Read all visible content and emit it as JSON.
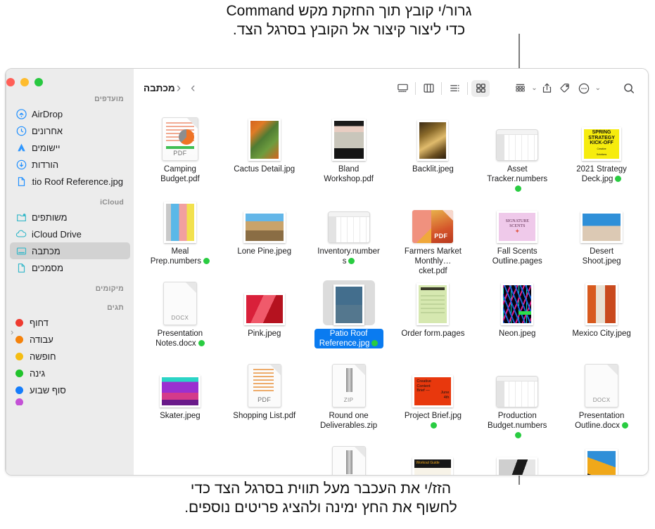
{
  "annotations": {
    "top": "גרור/י קובץ תוך החזקת מקש Command\nכדי ליצור קיצור אל הקובץ בסרגל הצד.",
    "bottom": "הזז/י את העכבר מעל תווית בסרגל הצד כדי\nלחשוף את החץ ימינה ולהציג פריטים נוספים."
  },
  "window": {
    "toolbar": {
      "title": "מכתבה",
      "back_label": "‹",
      "forward_label": "›",
      "search_icon": "search-icon",
      "more_icon": "more-ellipsis-icon",
      "tag_icon": "tag-icon",
      "share_icon": "share-icon",
      "group_icon": "group-by-icon",
      "view_gallery_icon": "gallery-view-icon",
      "view_column_icon": "column-view-icon",
      "view_list_icon": "list-view-icon",
      "view_icon_icon": "icon-view-icon",
      "chevron_label": "⌄"
    },
    "sidebar": {
      "traffic_lights": [
        "#ff5f57",
        "#febc2e",
        "#28c840"
      ],
      "sections": [
        {
          "header": "מועדפים",
          "items": [
            {
              "label": "AirDrop",
              "icon": "airdrop-icon",
              "selected": false
            },
            {
              "label": "אחרונים",
              "icon": "clock-icon",
              "selected": false
            },
            {
              "label": "יישומים",
              "icon": "applications-icon",
              "selected": false
            },
            {
              "label": "הורדות",
              "icon": "downloads-icon",
              "selected": false
            },
            {
              "label": "Patio Roof Reference.jpg",
              "icon": "document-icon",
              "selected": false
            }
          ]
        },
        {
          "header": "iCloud",
          "items": [
            {
              "label": "משותפים",
              "icon": "shared-folder-icon",
              "selected": false
            },
            {
              "label": "iCloud Drive",
              "icon": "cloud-icon",
              "selected": false
            },
            {
              "label": "מכתבה",
              "icon": "desktop-icon",
              "selected": true
            },
            {
              "label": "מסמכים",
              "icon": "document-icon",
              "selected": false
            }
          ]
        },
        {
          "header": "מיקומים",
          "items": []
        },
        {
          "header": "תגים",
          "items": [
            {
              "label": "דחוף",
              "icon": "tag-dot",
              "color": "#ee3b30",
              "selected": false
            },
            {
              "label": "עבודה",
              "icon": "tag-dot",
              "color": "#f5820b",
              "selected": false
            },
            {
              "label": "חופשה",
              "icon": "tag-dot",
              "color": "#f5bd12",
              "selected": false
            },
            {
              "label": "גינה",
              "icon": "tag-dot",
              "color": "#21c32c",
              "selected": false
            },
            {
              "label": "סוף שבוע",
              "icon": "tag-dot",
              "color": "#157dfb",
              "selected": false
            }
          ]
        }
      ],
      "expand_chevron": "‹"
    },
    "files": [
      {
        "name": "Camping Budget.pdf",
        "kind": "pdf",
        "tag": null,
        "selected": false
      },
      {
        "name": "Cactus Detail.jpg",
        "kind": "photo",
        "tag": null,
        "selected": false
      },
      {
        "name": "Bland Workshop.pdf",
        "kind": "photo",
        "tag": null,
        "selected": false
      },
      {
        "name": "Backlit.jpeg",
        "kind": "photo",
        "tag": null,
        "selected": false
      },
      {
        "name": "Asset Tracker.numbers",
        "kind": "sheet",
        "tag": "#29cc41",
        "selected": false
      },
      {
        "name": "2021 Strategy Deck.jpg",
        "kind": "photo",
        "tag": "#29cc41",
        "selected": false
      },
      {
        "name": "Meal Prep.numbers",
        "kind": "photo",
        "tag": "#29cc41",
        "selected": false
      },
      {
        "name": "Lone Pine.jpeg",
        "kind": "photo",
        "tag": null,
        "selected": false
      },
      {
        "name": "Inventory.numbers",
        "kind": "sheet",
        "tag": "#29cc41",
        "selected": false
      },
      {
        "name": "Farmers Market Monthly…cket.pdf",
        "kind": "pdf",
        "tag": null,
        "selected": false
      },
      {
        "name": "Fall Scents Outline.pages",
        "kind": "photo",
        "tag": null,
        "selected": false
      },
      {
        "name": "Desert Shoot.jpeg",
        "kind": "photo",
        "tag": null,
        "selected": false
      },
      {
        "name": "Presentation Notes.docx",
        "kind": "docx",
        "tag": "#29cc41",
        "selected": false
      },
      {
        "name": "Pink.jpeg",
        "kind": "photo",
        "tag": null,
        "selected": false
      },
      {
        "name": "Patio Roof Reference.jpg",
        "kind": "photo",
        "tag": "#29cc41",
        "selected": true
      },
      {
        "name": "Order form.pages",
        "kind": "photo",
        "tag": null,
        "selected": false
      },
      {
        "name": "Neon.jpeg",
        "kind": "photo",
        "tag": null,
        "selected": false
      },
      {
        "name": "Mexico City.jpeg",
        "kind": "photo",
        "tag": null,
        "selected": false
      },
      {
        "name": "Skater.jpeg",
        "kind": "photo",
        "tag": null,
        "selected": false
      },
      {
        "name": "Shopping List.pdf",
        "kind": "pdf",
        "tag": null,
        "selected": false
      },
      {
        "name": "Round one Deliverables.zip",
        "kind": "zip",
        "tag": null,
        "selected": false
      },
      {
        "name": "Project Brief.jpg",
        "kind": "photo",
        "tag": "#29cc41",
        "selected": false
      },
      {
        "name": "Production Budget.numbers",
        "kind": "sheet",
        "tag": "#29cc41",
        "selected": false
      },
      {
        "name": "Presentation Outline.docx",
        "kind": "docx",
        "tag": "#29cc41",
        "selected": false
      },
      {
        "name": "",
        "kind": "zip",
        "tag": null,
        "selected": false,
        "partial": true
      },
      {
        "name": "",
        "kind": "sheet2",
        "tag": null,
        "selected": false,
        "partial": true
      },
      {
        "name": "",
        "kind": "photo2",
        "tag": null,
        "selected": false,
        "partial": true
      },
      {
        "name": "",
        "kind": "photo3",
        "tag": null,
        "selected": false,
        "partial": true
      }
    ]
  }
}
